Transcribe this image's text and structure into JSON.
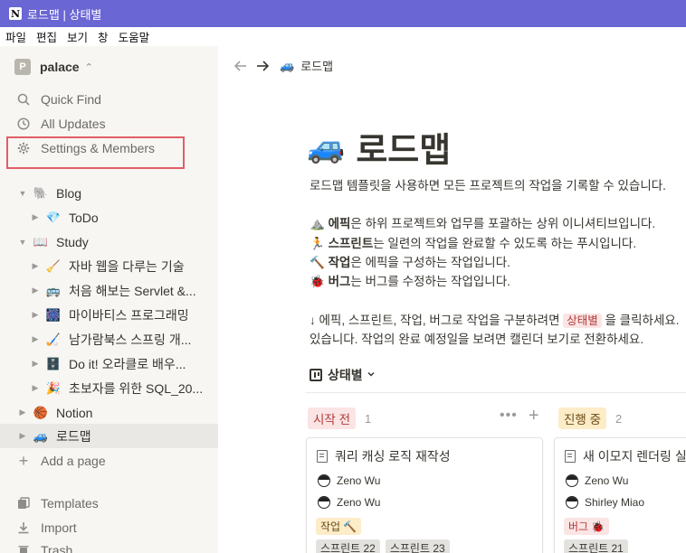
{
  "window": {
    "title": "로드맵 | 상태별",
    "app_icon": "N"
  },
  "menubar": [
    "파일",
    "편집",
    "보기",
    "창",
    "도움말"
  ],
  "sidebar": {
    "workspace": {
      "avatar": "P",
      "name": "palace"
    },
    "nav": [
      {
        "icon": "search-icon",
        "label": "Quick Find"
      },
      {
        "icon": "clock-icon",
        "label": "All Updates"
      },
      {
        "icon": "gear-icon",
        "label": "Settings & Members"
      }
    ],
    "tree": [
      {
        "toggle": "▼",
        "emoji": "🐘",
        "label": "Blog"
      },
      {
        "toggle": "▶",
        "emoji": "💎",
        "label": "ToDo"
      },
      {
        "toggle": "▼",
        "emoji": "📖",
        "label": "Study"
      },
      {
        "toggle": "▶",
        "emoji": "🧹",
        "label": "자바 웹을 다루는 기술"
      },
      {
        "toggle": "▶",
        "emoji": "🚌",
        "label": "처음 해보는 Servlet &..."
      },
      {
        "toggle": "▶",
        "emoji": "🎆",
        "label": "마이바티스 프로그래밍"
      },
      {
        "toggle": "▶",
        "emoji": "🏑",
        "label": "남가람북스 스프링 개..."
      },
      {
        "toggle": "▶",
        "emoji": "🗄️",
        "label": "Do it! 오라클로 배우..."
      },
      {
        "toggle": "▶",
        "emoji": "🎉",
        "label": "초보자를 위한 SQL_20..."
      },
      {
        "toggle": "▶",
        "emoji": "🏀",
        "label": "Notion"
      },
      {
        "toggle": "▶",
        "emoji": "🚙",
        "label": "로드맵"
      }
    ],
    "add_page": "Add a page",
    "bottom": [
      {
        "icon": "templates-icon",
        "label": "Templates"
      },
      {
        "icon": "import-icon",
        "label": "Import"
      },
      {
        "icon": "trash-icon",
        "label": "Trash"
      }
    ]
  },
  "main": {
    "breadcrumb": {
      "emoji": "🚙",
      "label": "로드맵"
    },
    "title": {
      "emoji": "🚙",
      "text": "로드맵"
    },
    "intro": "로드맵 템플릿을 사용하면 모든 프로젝트의 작업을 기록할 수 있습니다.",
    "bullets": [
      {
        "emoji": "⛰️",
        "bold": "에픽",
        "rest": "은 하위 프로젝트와 업무를 포괄하는 상위 이니셔티브입니다."
      },
      {
        "emoji": "🏃",
        "bold": "스프린트",
        "rest": "는 일련의 작업을 완료할 수 있도록 하는 푸시입니다."
      },
      {
        "emoji": "🔨",
        "bold": "작업",
        "rest": "은 에픽을 구성하는 작업입니다."
      },
      {
        "emoji": "🐞",
        "bold": "버그",
        "rest": "는 버그를 수정하는 작업입니다."
      }
    ],
    "hint_pre": "↓ 에픽, 스프린트, 작업, 버그로 작업을 구분하려면 ",
    "hint_tag": "상태별",
    "hint_post": " 을 클릭하세요.",
    "hint_line2": "있습니다. 작업의 완료 예정일을 보려면 캘린더 보기로 전환하세요.",
    "view": {
      "label": "상태별"
    },
    "columns": [
      {
        "label": "시작 전",
        "count": "1",
        "bg": "#fbe4e4",
        "fg": "#b13a3a"
      },
      {
        "label": "진행 중",
        "count": "2",
        "bg": "#fdecc8",
        "fg": "#6b4a14"
      }
    ],
    "cards": [
      {
        "title": "쿼리 캐싱 로직 재작성",
        "people": [
          "Zeno Wu",
          "Zeno Wu"
        ],
        "tag": {
          "label": "작업 🔨",
          "bg": "#fdecc8",
          "fg": "#6b4a14"
        },
        "sprints": [
          "스프린트 22",
          "스프린트 23"
        ]
      },
      {
        "title": "새 이모지 렌더링 실패",
        "people": [
          "Zeno Wu",
          "Shirley Miao"
        ],
        "tag": {
          "label": "버그 🐞",
          "bg": "#fbe4e4",
          "fg": "#b13a3a"
        },
        "sprints": [
          "스프린트 21"
        ]
      }
    ]
  },
  "colors": {
    "titlebar": "#6a66d4",
    "sidebar": "#f7f6f3",
    "highlight": "#e05f66"
  }
}
